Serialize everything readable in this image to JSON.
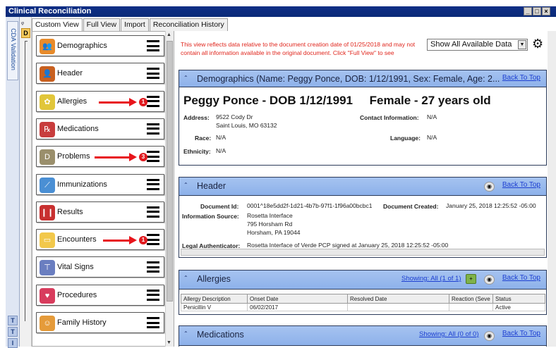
{
  "window": {
    "title": "Clinical Reconciliation",
    "controls": [
      "_",
      "□",
      "×"
    ]
  },
  "left_rail": {
    "label": "CDA Validation",
    "pin": "ᵩ",
    "d_button": "D",
    "bottom_tabs": [
      "T",
      "T",
      "I"
    ]
  },
  "tabs": [
    {
      "label": "Custom View",
      "active": true
    },
    {
      "label": "Full View",
      "active": false
    },
    {
      "label": "Import",
      "active": false
    },
    {
      "label": "Reconciliation History",
      "active": false
    }
  ],
  "nav_items": [
    {
      "label": "Demographics",
      "icon": "people-icon",
      "color": "#e88b2b"
    },
    {
      "label": "Header",
      "icon": "person-icon",
      "color": "#c8601f"
    },
    {
      "label": "Allergies",
      "icon": "flower-icon",
      "color": "#e1c63a",
      "badge": "1"
    },
    {
      "label": "Medications",
      "icon": "rx-icon",
      "color": "#c83d3d"
    },
    {
      "label": "Problems",
      "icon": "dx-icon",
      "color": "#9a8f6c",
      "badge": "3"
    },
    {
      "label": "Immunizations",
      "icon": "syringe-icon",
      "color": "#4a8fd4"
    },
    {
      "label": "Results",
      "icon": "test-tubes-icon",
      "color": "#c83030"
    },
    {
      "label": "Encounters",
      "icon": "folder-icon",
      "color": "#f2c84b",
      "badge": "1"
    },
    {
      "label": "Vital Signs",
      "icon": "thermometer-icon",
      "color": "#6a7ec0"
    },
    {
      "label": "Procedures",
      "icon": "heart-icon",
      "color": "#d83c5d"
    },
    {
      "label": "Family History",
      "icon": "family-icon",
      "color": "#e59b3a"
    }
  ],
  "main": {
    "notice": "This view reflects data relative to the document creation date of 01/25/2018 and may not contain all information available in the original document. Click \"Full View\" to see",
    "show_select": "Show All Available Data",
    "back_to_top": "Back To Top",
    "demographics": {
      "title": "Demographics (Name: Peggy Ponce, DOB: 1/12/1991, Sex: Female, Age: 2...",
      "headline": "Peggy Ponce - DOB 1/12/1991     Female - 27 years old",
      "address_label": "Address:",
      "address_line1": "9522 Cody Dr",
      "address_line2": "Saint Louis, MO 63132",
      "contact_label": "Contact Information:",
      "contact_value": "N/A",
      "race_label": "Race:",
      "race_value": "N/A",
      "language_label": "Language:",
      "language_value": "N/A",
      "ethnicity_label": "Ethnicity:",
      "ethnicity_value": "N/A"
    },
    "header": {
      "title": "Header",
      "doc_id_label": "Document Id:",
      "doc_id_value": "0001^18e5dd2f-1d21-4b7b-97f1-1f96a00bcbc1",
      "doc_created_label": "Document Created:",
      "doc_created_value": "January 25, 2018 12:25:52 -05:00",
      "info_source_label": "Information Source:",
      "info_source_line1": "Rosetta Interface",
      "info_source_line2": "795 Horsham Rd",
      "info_source_line3": "Horsham, PA 19044",
      "legal_auth_label": "Legal Authenticator:",
      "legal_auth_value": "Rosetta Interface of Verde PCP signed at January 25, 2018 12:25:52 -05:00"
    },
    "allergies": {
      "title": "Allergies",
      "showing": "Showing: All (1 of 1)",
      "columns": [
        "Allergy Description",
        "Onset Date",
        "Resolved Date",
        "Reaction (Seve",
        "Status"
      ],
      "rows": [
        [
          "Penicillin V",
          "06/02/2017",
          "",
          "",
          "Active"
        ]
      ]
    },
    "medications": {
      "title": "Medications",
      "showing": "Showing: All (0 of 0)"
    }
  }
}
